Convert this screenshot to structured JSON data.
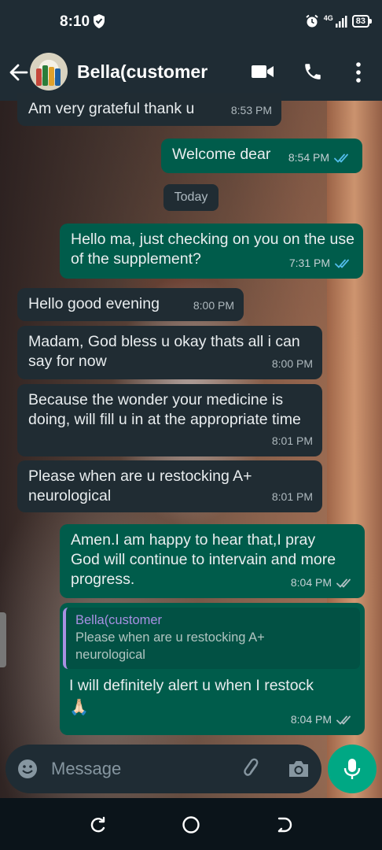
{
  "status_bar": {
    "time": "8:10",
    "battery": "83",
    "signal_badge": "4G",
    "icons": [
      "shield-icon",
      "alarm-icon",
      "signal-icon",
      "battery-icon"
    ]
  },
  "header": {
    "contact_name": "Bella(customer",
    "icons": [
      "back-arrow-icon",
      "video-call-icon",
      "voice-call-icon",
      "more-options-icon"
    ]
  },
  "date_chip": "Today",
  "messages": [
    {
      "direction": "in",
      "text": "Am very grateful thank u",
      "time": "8:53 PM"
    },
    {
      "direction": "out",
      "text": "Welcome dear",
      "time": "8:54 PM",
      "ticks": "read"
    },
    {
      "direction": "out",
      "text": "Hello ma, just checking on you on the use of the supplement?",
      "time": "7:31 PM",
      "ticks": "read"
    },
    {
      "direction": "in",
      "text": "Hello good evening",
      "time": "8:00 PM"
    },
    {
      "direction": "in",
      "text": "Madam,  God bless u okay thats all i can say for now",
      "time": "8:00 PM"
    },
    {
      "direction": "in",
      "text": "Because the wonder your medicine is doing,  will fill u in at the appropriate time",
      "time": "8:01 PM"
    },
    {
      "direction": "in",
      "text": "Please when are u restocking  A+ neurological",
      "time": "8:01 PM"
    },
    {
      "direction": "out",
      "text": "Amen.I am happy to hear that,I pray God will continue to intervain and more progress.",
      "time": "8:04 PM",
      "ticks": "delivered"
    },
    {
      "direction": "out",
      "quote_name": "Bella(customer",
      "quote_text": "Please when are u restocking  A+ neurological",
      "text": "I will definitely alert u when I restock",
      "emoji": "🙏🏻",
      "time": "8:04 PM",
      "ticks": "delivered"
    }
  ],
  "composer": {
    "placeholder": "Message",
    "icons": [
      "emoji-icon",
      "attach-icon",
      "camera-icon",
      "mic-icon"
    ]
  },
  "colors": {
    "outgoing": "#005c4b",
    "incoming": "#202c33",
    "accent": "#00a884",
    "read_tick": "#53bdeb",
    "quote_name": "#a890e3"
  }
}
